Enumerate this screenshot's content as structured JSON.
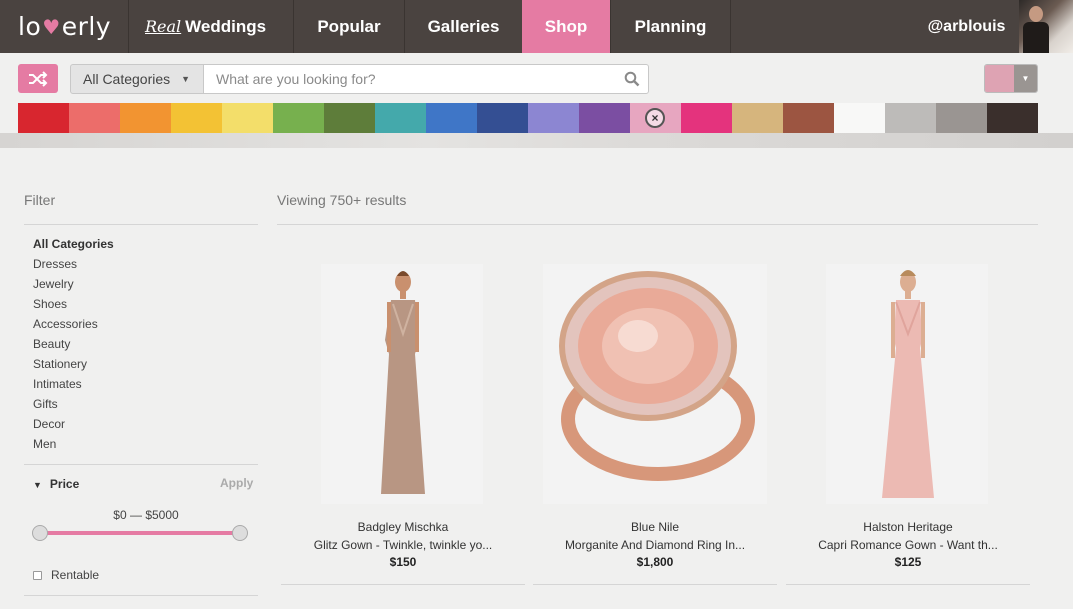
{
  "brand": {
    "logo_text_a": "lo",
    "logo_text_b": "erly"
  },
  "nav": {
    "real_weddings_script": "Real",
    "real_weddings_label": "Weddings",
    "popular": "Popular",
    "galleries": "Galleries",
    "shop": "Shop",
    "planning": "Planning",
    "active": "Shop",
    "user": "@arblouis"
  },
  "search": {
    "category": "All Categories",
    "placeholder": "What are you looking for?",
    "selected_color": "#dea3b3"
  },
  "colors": [
    "#d8262f",
    "#ec6d6a",
    "#f29431",
    "#f3c234",
    "#f3de6a",
    "#77b04e",
    "#5e7d3a",
    "#44a9ab",
    "#3f76c7",
    "#344f93",
    "#8c86d2",
    "#7b4ea2",
    "#e7a6c0",
    "#e4337d",
    "#d6b57d",
    "#9c5541",
    "#f8f8f7",
    "#bdbbb9",
    "#9a9592",
    "#3a2f2c"
  ],
  "selected_color_index": 12,
  "sidebar": {
    "filter_title": "Filter",
    "categories": [
      "All Categories",
      "Dresses",
      "Jewelry",
      "Shoes",
      "Accessories",
      "Beauty",
      "Stationery",
      "Intimates",
      "Gifts",
      "Decor",
      "Men"
    ],
    "price_label": "Price",
    "apply_label": "Apply",
    "price_range": "$0 — $5000",
    "rentable_label": "Rentable"
  },
  "results": {
    "viewing": "Viewing 750+ results",
    "products": [
      {
        "brand": "Badgley Mischka",
        "name": "Glitz Gown - Twinkle, twinkle yo...",
        "price": "$150"
      },
      {
        "brand": "Blue Nile",
        "name": "Morganite And Diamond Ring In...",
        "price": "$1,800"
      },
      {
        "brand": "Halston Heritage",
        "name": "Capri Romance Gown - Want th...",
        "price": "$125"
      }
    ]
  }
}
